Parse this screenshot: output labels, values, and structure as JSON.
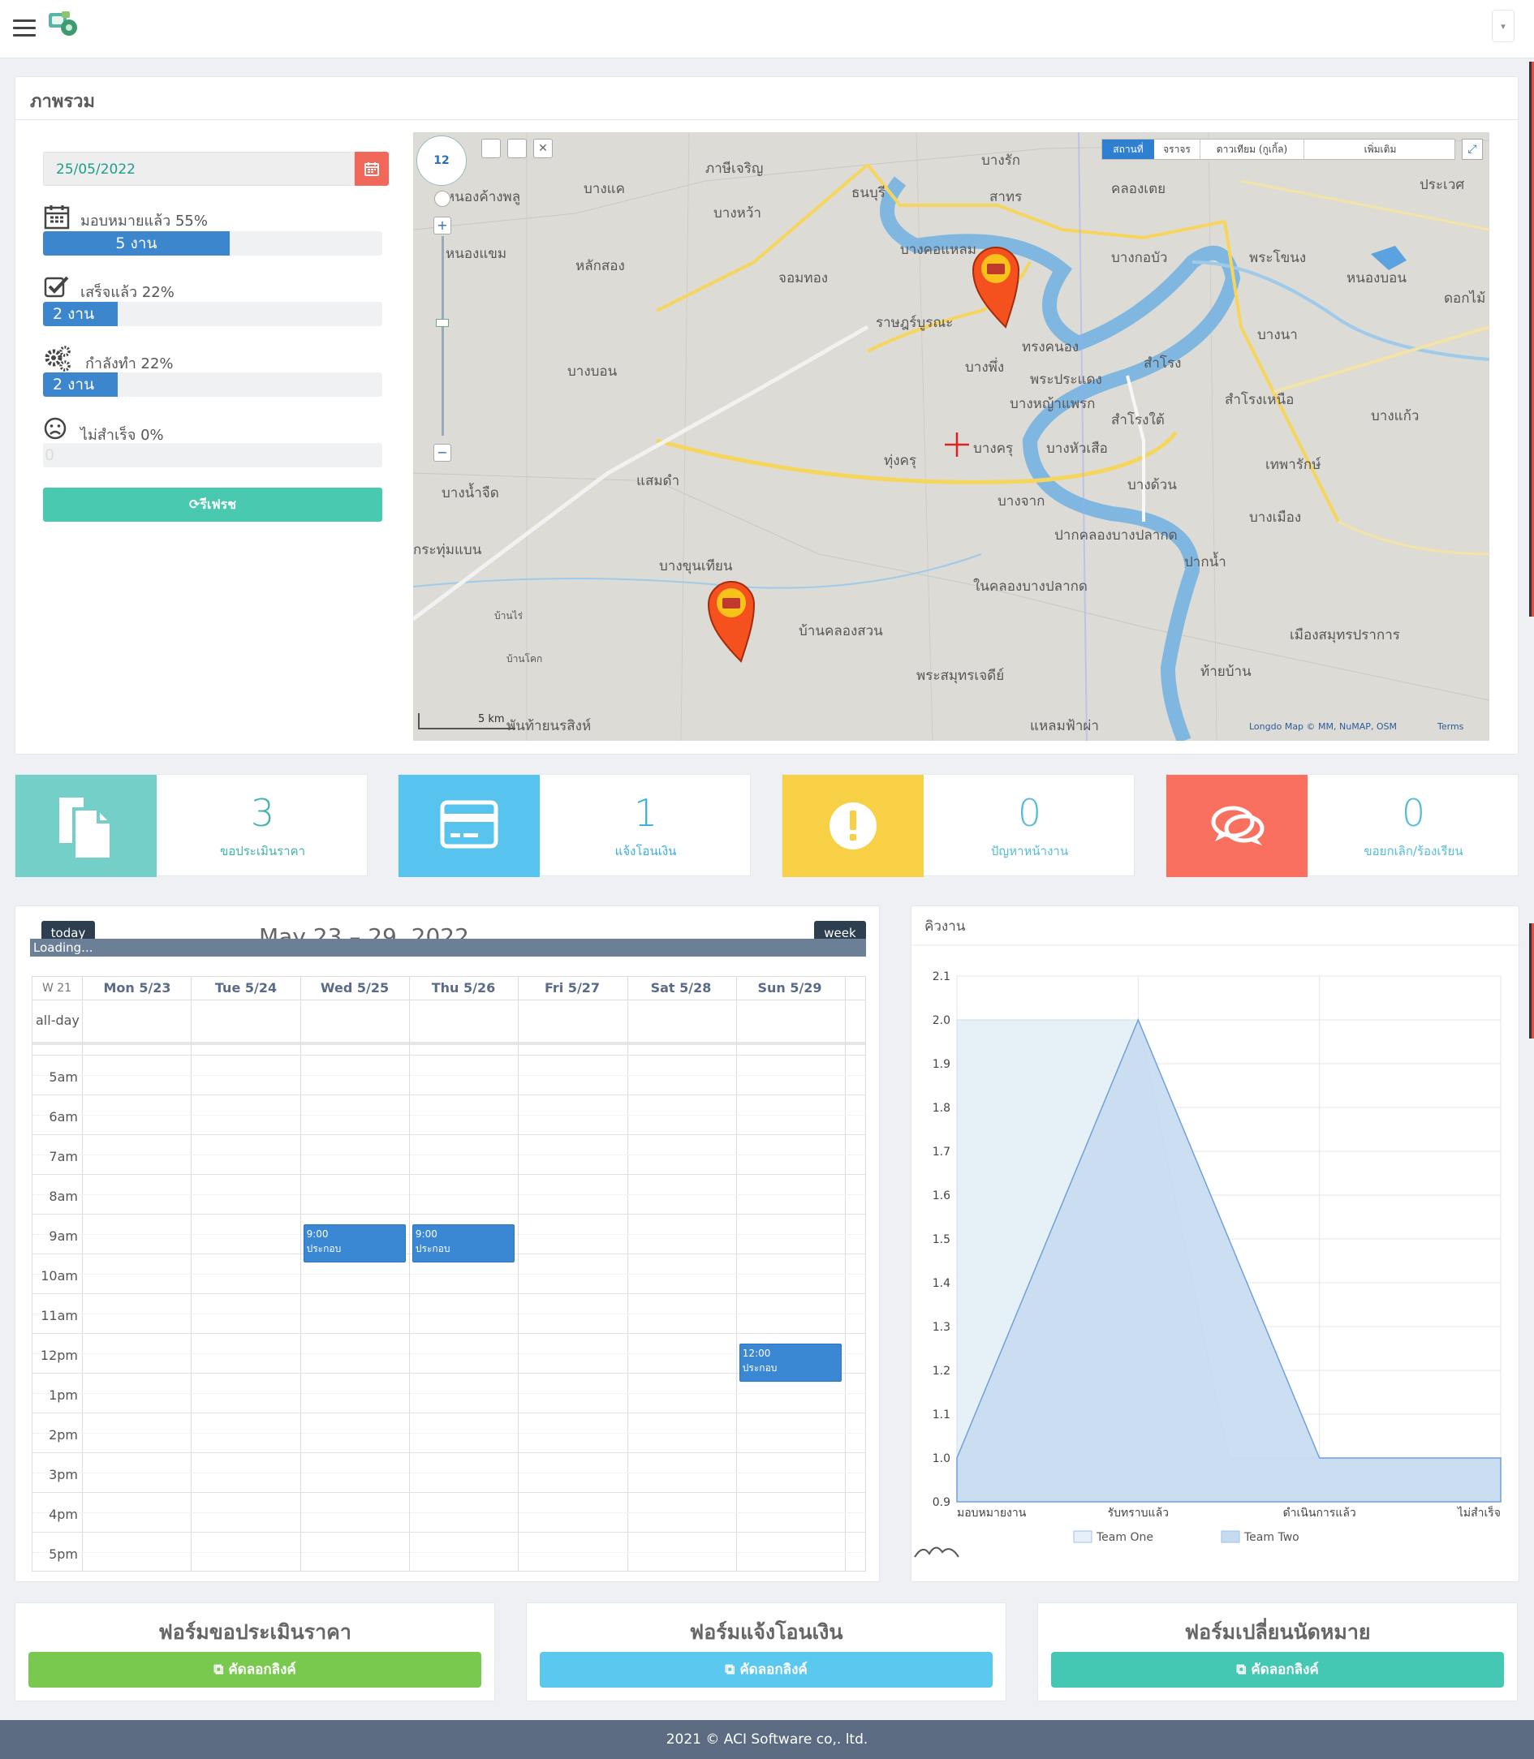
{
  "overview": {
    "title": "ภาพรวม",
    "date_value": "25/05/2022",
    "stats": [
      {
        "label": "มอบหมายแล้ว 55%",
        "bar_text": "5 งาน",
        "fill": 0.55
      },
      {
        "label": "เสร็จแล้ว 22%",
        "bar_text": "2 งาน",
        "fill": 0.22
      },
      {
        "label": "กำลังทำ 22%",
        "bar_text": "2 งาน",
        "fill": 0.22
      },
      {
        "label": "ไม่สำเร็จ 0%",
        "bar_text": "0",
        "fill": 0
      }
    ],
    "refresh_label": "รีเฟรช"
  },
  "map": {
    "zoom": "12",
    "tabs": [
      "สถานที่",
      "จราจร",
      "ดาวเทียม (กูเกิ้ล)",
      "เพิ่มเติม"
    ],
    "scale": "5 km",
    "attribution": "Longdo Map © MM, NuMAP, OSM",
    "terms": "Terms",
    "places": [
      "บางรัก",
      "สาทร",
      "คลองเตย",
      "ธนบุรี",
      "บางคอแหลม",
      "จอมทอง",
      "ราษฎร์บูรณะ",
      "บางพึ่ง",
      "พระประแดง",
      "ทุ่งครุ",
      "บางขุนเทียน",
      "บางบอน",
      "หนองแขม",
      "หลักสอง",
      "ภาษีเจริญ",
      "บางแค",
      "บางหว้า",
      "แสมดำ",
      "ปากน้ำ",
      "เมืองสมุทรปราการ",
      "พระสมุทรเจดีย์",
      "พันท้ายนรสิงห์",
      "บางกอบัว",
      "สำโรง",
      "สำโรงเหนือ",
      "เทพารักษ์",
      "บางเมือง",
      "ประเวศ",
      "หนองบอน",
      "พระโขนง",
      "บางนา",
      "บางแก้ว",
      "ท้ายบ้าน",
      "บางจาก",
      "บางครุ",
      "บางหัวเสือ",
      "ทรงคนอง",
      "ในคลองบางปลากด",
      "ปากคลองบางปลากด",
      "บ้านคลองสวน",
      "แหลมฟ้าผ่า",
      "บางน้ำจืด",
      "กระทุ่มแบน",
      "บ้านไร่",
      "บ้านโคก",
      "บางด้วน",
      "บางหญ้าแพรก",
      "ดอกไม้",
      "สำโรงใต้",
      "หนองค้างพลู"
    ]
  },
  "kpis": [
    {
      "value": "3",
      "label": "ขอประเมินราคา",
      "color": "#73cfc8"
    },
    {
      "value": "1",
      "label": "แจ้งโอนเงิน",
      "color": "#57c4f0"
    },
    {
      "value": "0",
      "label": "ปัญหาหน้างาน",
      "color": "#f7d046"
    },
    {
      "value": "0",
      "label": "ขอยกเลิก/ร้องเรียน",
      "color": "#f9705f"
    }
  ],
  "calendar": {
    "today_label": "today",
    "range_title": "May 23 – 29, 2022",
    "view_label": "week",
    "loading_text": "Loading...",
    "week_label": "W 21",
    "days": [
      "Mon 5/23",
      "Tue 5/24",
      "Wed 5/25",
      "Thu 5/26",
      "Fri 5/27",
      "Sat 5/28",
      "Sun 5/29"
    ],
    "all_day": "all-day",
    "times": [
      "5am",
      "6am",
      "7am",
      "8am",
      "9am",
      "10am",
      "11am",
      "12pm",
      "1pm",
      "2pm",
      "3pm",
      "4pm",
      "5pm"
    ],
    "events": [
      {
        "day": 2,
        "start_hour": 9,
        "time": "9:00",
        "title": "ประกอบ"
      },
      {
        "day": 3,
        "start_hour": 9,
        "time": "9:00",
        "title": "ประกอบ"
      },
      {
        "day": 6,
        "start_hour": 12,
        "time": "12:00",
        "title": "ประกอบ"
      }
    ]
  },
  "chart_data": {
    "type": "area",
    "title": "คิวงาน",
    "categories": [
      "มอบหมายงาน",
      "รับทราบแล้ว",
      "ดำเนินการแล้ว",
      "ไม่สำเร็จ"
    ],
    "x_points": [
      0,
      1,
      2,
      3,
      4,
      5,
      6
    ],
    "series": [
      {
        "name": "Team One",
        "values": [
          2,
          2,
          2,
          1,
          1,
          1,
          1
        ],
        "color": "#e6f1f7"
      },
      {
        "name": "Team Two",
        "values": [
          1,
          1.5,
          2,
          1.5,
          1,
          1,
          1
        ],
        "color": "#c6daf0"
      }
    ],
    "ylim": [
      0.9,
      2.1
    ],
    "yticks": [
      "2.1",
      "2.0",
      "1.9",
      "1.8",
      "1.7",
      "1.6",
      "1.5",
      "1.4",
      "1.3",
      "1.2",
      "1.1",
      "1.0",
      "0.9"
    ],
    "legend": [
      "Team One",
      "Team Two"
    ],
    "legend_position": "bottom",
    "grid": true
  },
  "forms": [
    {
      "title": "ฟอร์มขอประเมินราคา",
      "button": "คัดลอกลิงค์",
      "color": "#79c94f"
    },
    {
      "title": "ฟอร์มแจ้งโอนเงิน",
      "button": "คัดลอกลิงค์",
      "color": "#5bc8f0"
    },
    {
      "title": "ฟอร์มเปลี่ยนนัดหมาย",
      "button": "คัดลอกลิงค์",
      "color": "#44c8b4"
    }
  ],
  "footer": "2021 © ACI Software co,. ltd."
}
